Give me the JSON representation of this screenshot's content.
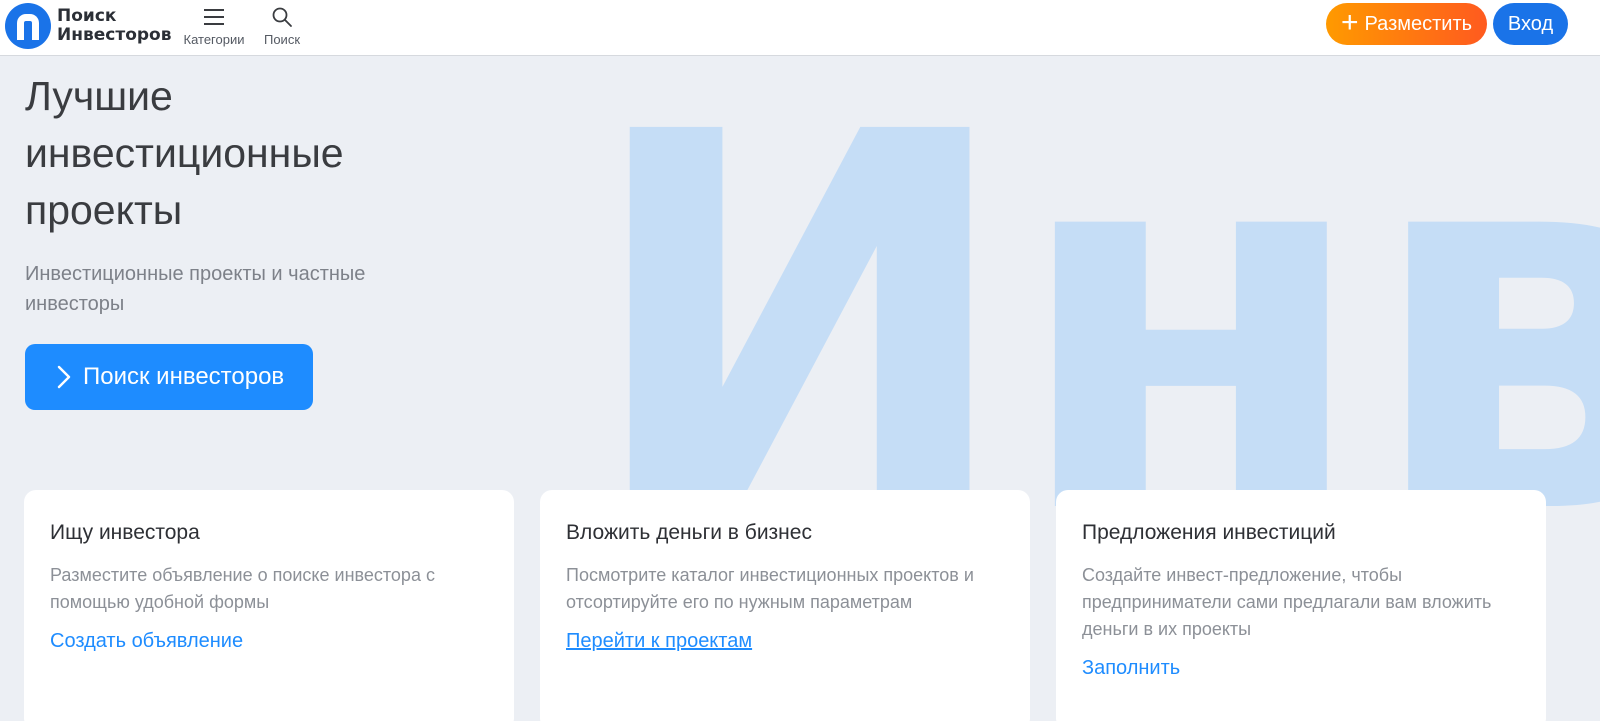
{
  "header": {
    "logo": {
      "line1": "Поиск",
      "line2": "Инвесторов"
    },
    "nav": {
      "categories_label": "Категории",
      "search_label": "Поиск"
    },
    "post_button_label": "Разместить",
    "login_button_label": "Вход"
  },
  "hero": {
    "title": "Лучшие инвестиционные проекты",
    "subtitle": "Инвестиционные проекты и частные инвесторы",
    "cta_label": "Поиск инвесторов",
    "background_word": "Инв"
  },
  "cards": [
    {
      "title": "Ищу инвестора",
      "text": "Разместите объявление о поиске инвестора с помощью удобной формы",
      "link": "Создать объявление"
    },
    {
      "title": "Вложить деньги в бизнес",
      "text": "Посмотрите каталог инвестиционных проектов и отсортируйте его по нужным параметрам",
      "link": "Перейти к проектам"
    },
    {
      "title": "Предложения инвестиций",
      "text": "Создайте инвест-предложение, чтобы предприниматели сами предлагали вам вложить деньги в их проекты",
      "link": "Заполнить"
    }
  ],
  "colors": {
    "brand_blue": "#1a73e8",
    "cta_blue": "#1e8cff",
    "orange_start": "#ff9a00",
    "orange_end": "#ff5a1f",
    "hero_background": "#eceff4",
    "watermark": "#c5ddf6"
  },
  "icons": {
    "logo": "logo-p-icon",
    "categories": "menu-icon",
    "search": "search-icon",
    "post": "plus-icon",
    "cta": "chevron-right-icon"
  }
}
